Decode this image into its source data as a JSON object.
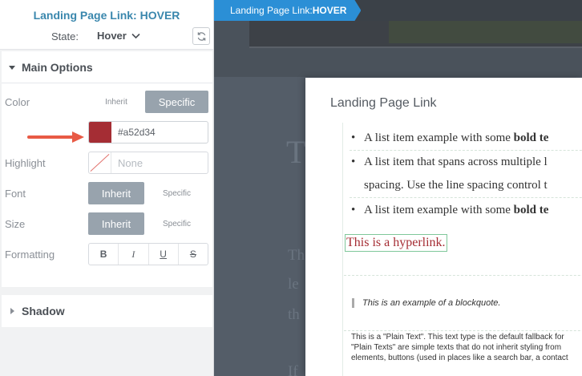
{
  "panel": {
    "title": "Landing Page Link: HOVER",
    "state_label": "State:",
    "state_value": "Hover"
  },
  "main_options": {
    "title": "Main Options",
    "color": {
      "label": "Color",
      "options": [
        "Inherit",
        "Specific"
      ],
      "selected": "Specific",
      "value": "#a52d34"
    },
    "highlight": {
      "label": "Highlight",
      "placeholder": "None"
    },
    "font": {
      "label": "Font",
      "options": [
        "Inherit",
        "Specific"
      ],
      "selected": "Inherit"
    },
    "size": {
      "label": "Size",
      "options": [
        "Inherit",
        "Specific"
      ],
      "selected": "Inherit"
    },
    "formatting": {
      "label": "Formatting",
      "buttons": [
        "B",
        "I",
        "U",
        "S"
      ]
    }
  },
  "shadow": {
    "title": "Shadow"
  },
  "breadcrumb": {
    "prefix": "Landing Page Link: ",
    "state": "HOVER"
  },
  "modal": {
    "title": "Landing Page Link",
    "list": [
      {
        "text": "A list item example with some ",
        "bold": "bold te"
      },
      {
        "text": "A list item that spans across multiple l",
        "bold": ""
      },
      {
        "text": "spacing. Use the line spacing control t",
        "bold": ""
      },
      {
        "text": "A list item example with some ",
        "bold": "bold te"
      }
    ],
    "hyperlink": "This is a hyperlink.",
    "blockquote": "This is an example of a blockquote.",
    "plain_lines": [
      "This is a \"Plain Text\". This text type is the default fallback for",
      "\"Plain Texts\" are simple texts that do not inherit styling from",
      "elements, buttons (used in places like a search bar, a contact"
    ]
  },
  "background": {
    "ghost_heading": "T",
    "ghost_lines": [
      "Th",
      "le",
      "th"
    ],
    "ghost_bottom": "If"
  },
  "colors": {
    "accent": "#3a87ad",
    "breadcrumb_bg": "#2b8fd6",
    "swatch": "#a52d34",
    "arrow": "#e85a45"
  }
}
